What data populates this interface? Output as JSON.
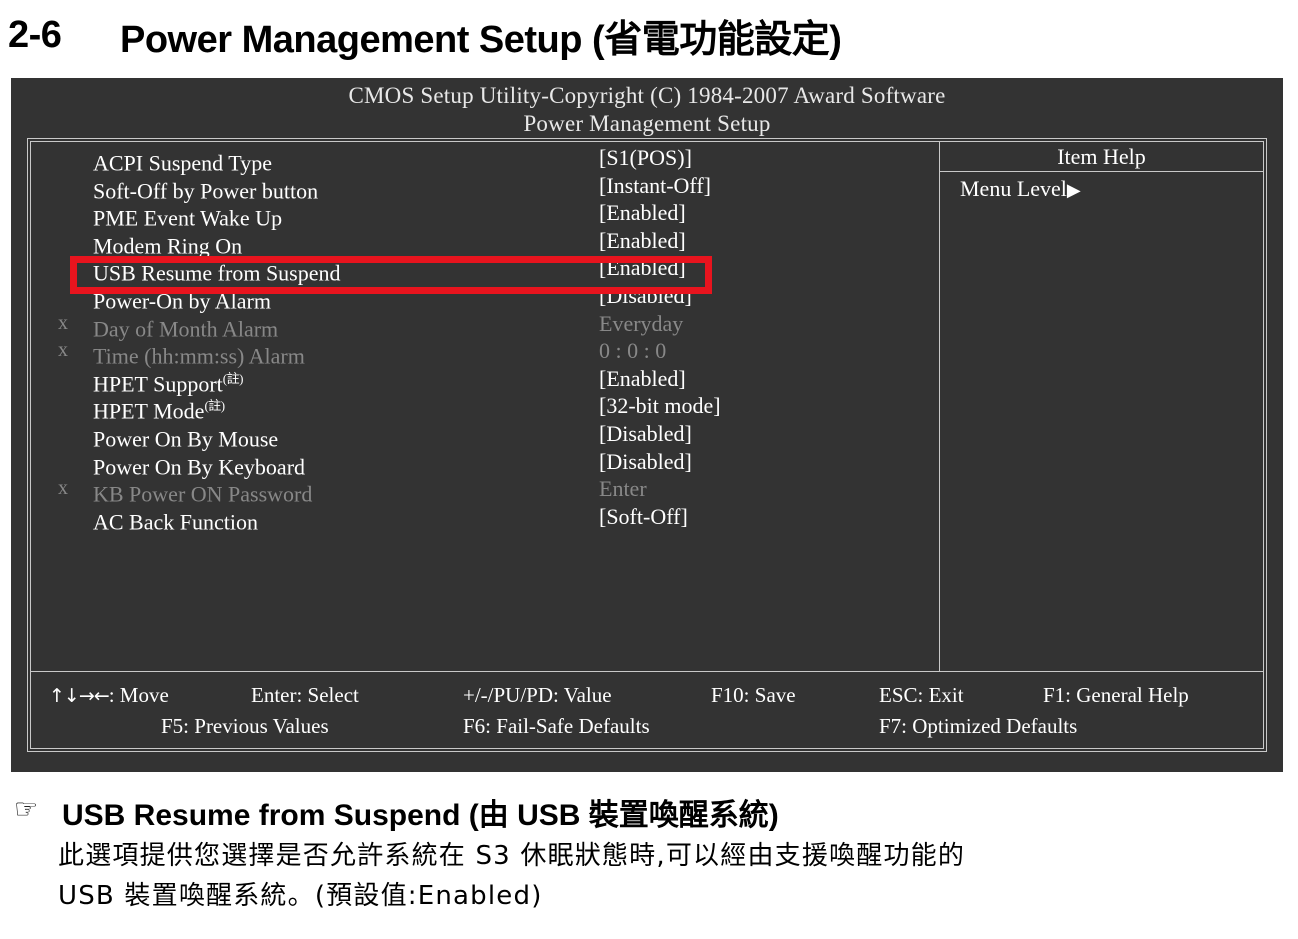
{
  "section": {
    "number": "2-6",
    "title": "Power Management Setup (省電功能設定)"
  },
  "bios": {
    "title_line1": "CMOS Setup Utility-Copyright (C) 1984-2007 Award Software",
    "title_line2": "Power Management Setup",
    "colors": {
      "background": "#333333",
      "border": "#c9c9c9",
      "text": "#ffffff",
      "disabled_text": "#888888",
      "highlight": "#e8141e"
    },
    "settings": [
      {
        "prefix": "",
        "label": "ACPI Suspend Type",
        "value": "[S1(POS)]",
        "dim": false,
        "note": ""
      },
      {
        "prefix": "",
        "label": "Soft-Off by Power button",
        "value": "[Instant-Off]",
        "dim": false,
        "note": ""
      },
      {
        "prefix": "",
        "label": "PME Event Wake Up",
        "value": "[Enabled]",
        "dim": false,
        "note": ""
      },
      {
        "prefix": "",
        "label": "Modem Ring On",
        "value": "[Enabled]",
        "dim": false,
        "note": ""
      },
      {
        "prefix": "",
        "label": "USB Resume from Suspend",
        "value": "[Enabled]",
        "dim": false,
        "note": ""
      },
      {
        "prefix": "",
        "label": "Power-On by Alarm",
        "value": "[Disabled]",
        "dim": false,
        "note": ""
      },
      {
        "prefix": "x",
        "label": "Day of Month Alarm",
        "value": "Everyday",
        "dim": true,
        "note": ""
      },
      {
        "prefix": "x",
        "label": "Time (hh:mm:ss) Alarm",
        "value": "0 : 0 : 0",
        "dim": true,
        "note": ""
      },
      {
        "prefix": "",
        "label": "HPET Support",
        "value": "[Enabled]",
        "dim": false,
        "note": "(註)"
      },
      {
        "prefix": "",
        "label": "HPET Mode",
        "value": "[32-bit mode]",
        "dim": false,
        "note": "(註)"
      },
      {
        "prefix": "",
        "label": "Power On By Mouse",
        "value": "[Disabled]",
        "dim": false,
        "note": ""
      },
      {
        "prefix": "",
        "label": "Power On By Keyboard",
        "value": "[Disabled]",
        "dim": false,
        "note": ""
      },
      {
        "prefix": "x",
        "label": "KB Power ON Password",
        "value": "Enter",
        "dim": true,
        "note": ""
      },
      {
        "prefix": "",
        "label": "AC Back Function",
        "value": "[Soft-Off]",
        "dim": false,
        "note": ""
      }
    ],
    "help": {
      "title": "Item Help",
      "menu_level_label": "Menu Level",
      "menu_level_arrow": "▶"
    },
    "keys": {
      "move_arrows": "↑↓→←",
      "move": ": Move",
      "enter": "Enter: Select",
      "value": "+/-/PU/PD: Value",
      "save": "F10: Save",
      "esc": "ESC: Exit",
      "general_help": "F1: General Help",
      "previous_values": "F5: Previous Values",
      "fail_safe": "F6: Fail-Safe Defaults",
      "optimized": "F7: Optimized Defaults"
    },
    "highlighted_setting": "USB Resume from Suspend"
  },
  "note": {
    "hand_icon": "☞",
    "heading": "USB Resume from Suspend (由 USB 裝置喚醒系統)",
    "paragraph_line1": "此選項提供您選擇是否允許系統在 S3 休眠狀態時,可以經由支援喚醒功能的",
    "paragraph_line2": "USB 裝置喚醒系統。(預設值:Enabled)"
  }
}
